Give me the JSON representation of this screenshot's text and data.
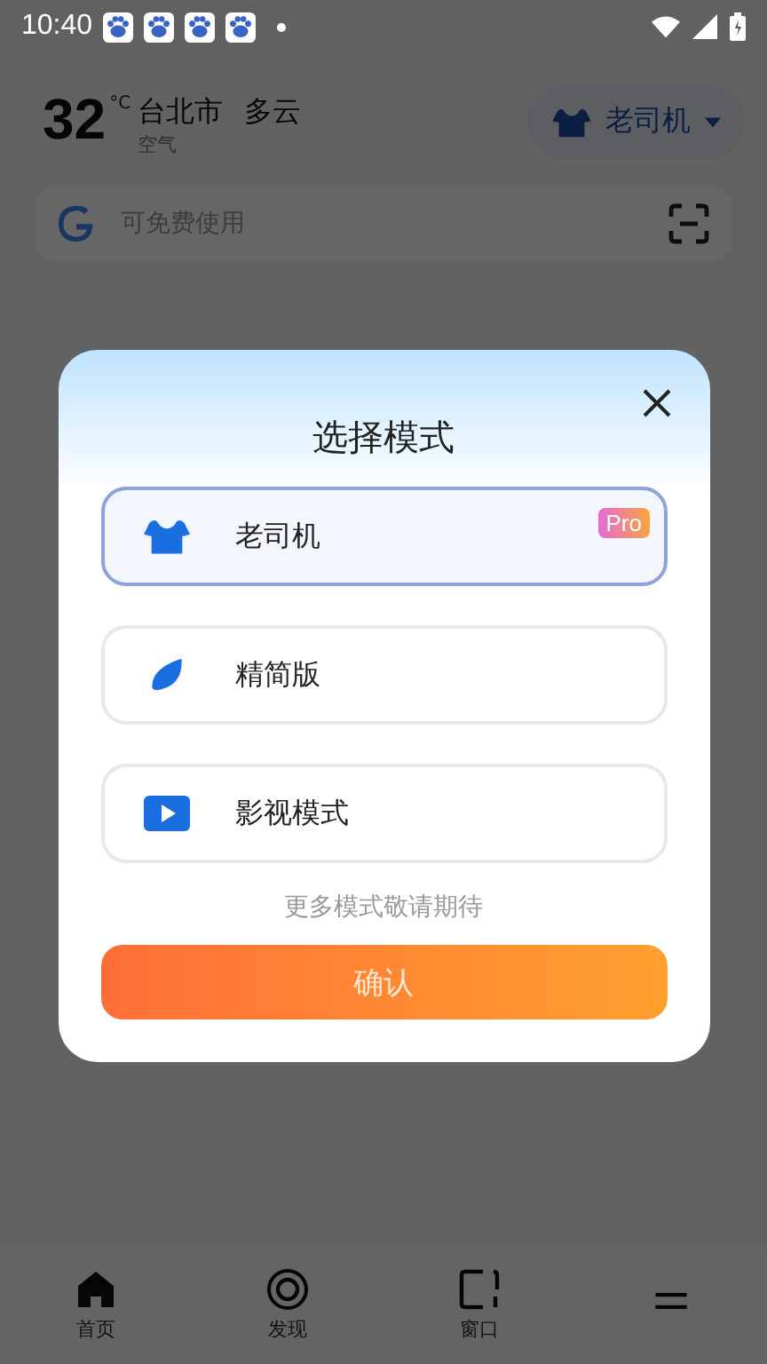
{
  "status_bar": {
    "time": "10:40",
    "notifications": [
      {
        "kind": "paw"
      },
      {
        "kind": "paw"
      },
      {
        "kind": "paw"
      },
      {
        "kind": "paw"
      }
    ]
  },
  "weather": {
    "temperature": "32",
    "unit": "°C",
    "city": "台北市",
    "condition": "多云",
    "air": "空气"
  },
  "mode_chip": {
    "label": "老司机"
  },
  "search": {
    "placeholder": "可免费使用"
  },
  "dialog": {
    "title": "选择模式",
    "options": [
      {
        "kind": "driver",
        "label": "老司机",
        "badge": "Pro",
        "selected": true
      },
      {
        "kind": "leaf",
        "label": "精简版",
        "selected": false
      },
      {
        "kind": "video",
        "label": "影视模式",
        "selected": false
      }
    ],
    "hint": "更多模式敬请期待",
    "confirm": "确认"
  },
  "nav": [
    {
      "kind": "home",
      "label": "首页"
    },
    {
      "kind": "discover",
      "label": "发现"
    },
    {
      "kind": "window",
      "label": "窗口"
    },
    {
      "kind": "menu"
    }
  ]
}
